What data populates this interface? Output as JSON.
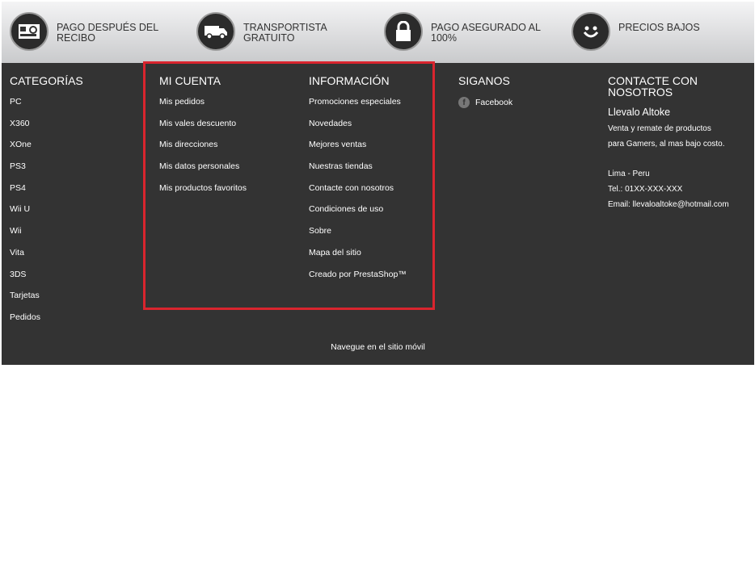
{
  "features": [
    {
      "icon": "cash-register-icon",
      "label": "Pago después del recibo"
    },
    {
      "icon": "delivery-truck-icon",
      "label": "Transportista gratuito"
    },
    {
      "icon": "padlock-icon",
      "label": "Pago asegurado al 100%"
    },
    {
      "icon": "smiley-icon",
      "label": "Precios bajos"
    }
  ],
  "categories": {
    "title": "CATEGORÍAS",
    "items": [
      "PC",
      "X360",
      "XOne",
      "PS3",
      "PS4",
      "Wii U",
      "Wii",
      "Vita",
      "3DS",
      "Tarjetas",
      "Pedidos"
    ]
  },
  "account": {
    "title": "MI CUENTA",
    "items": [
      "Mis pedidos",
      "Mis vales descuento",
      "Mis direcciones",
      "Mis datos personales",
      "Mis productos favoritos"
    ]
  },
  "information": {
    "title": "INFORMACIÓN",
    "items": [
      "Promociones especiales",
      "Novedades",
      "Mejores ventas",
      "Nuestras tiendas",
      "Contacte con nosotros",
      "Condiciones de uso",
      "Sobre",
      "Mapa del sitio",
      "Creado por PrestaShop™"
    ]
  },
  "social": {
    "title": "SIGANOS",
    "facebook_label": "Facebook"
  },
  "contact": {
    "title": "CONTACTE CON NOSOTROS",
    "brand": "Llevalo Altoke",
    "description": "Venta y remate de productos para Gamers, al mas bajo costo.",
    "location": "Lima - Peru",
    "phone": "Tel.: 01XX-XXX-XXX",
    "email": "Email: llevaloaltoke@hotmail.com"
  },
  "mobile_link": "Navegue en el sitio móvil",
  "colors": {
    "highlight": "#d9252e",
    "footer_bg": "#333333"
  }
}
